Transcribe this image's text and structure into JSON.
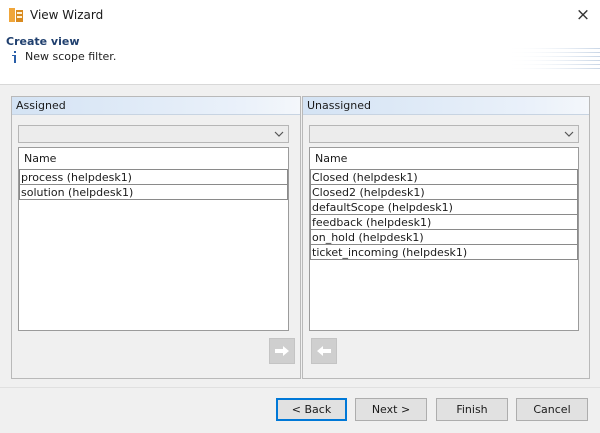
{
  "window": {
    "title": "View Wizard",
    "close_glyph": "×"
  },
  "header": {
    "title": "Create view",
    "message": "New scope filter."
  },
  "assigned": {
    "title": "Assigned",
    "column_header": "Name",
    "rows": [
      "process (helpdesk1)",
      "solution (helpdesk1)"
    ]
  },
  "unassigned": {
    "title": "Unassigned",
    "column_header": "Name",
    "rows": [
      "Closed (helpdesk1)",
      "Closed2 (helpdesk1)",
      "defaultScope (helpdesk1)",
      "feedback (helpdesk1)",
      "on_hold (helpdesk1)",
      "ticket_incoming (helpdesk1)"
    ]
  },
  "buttons": {
    "back": "< Back",
    "next": "Next >",
    "finish": "Finish",
    "cancel": "Cancel"
  },
  "icons": {
    "app": "view-wizard-icon",
    "info": "info-icon",
    "move_left_to_right": "arrow-right-icon",
    "move_right_to_left": "arrow-left-icon"
  },
  "colors": {
    "accent": "#0078d7",
    "header_title": "#1f3f6e",
    "panel_header": "#d4e3f4"
  }
}
